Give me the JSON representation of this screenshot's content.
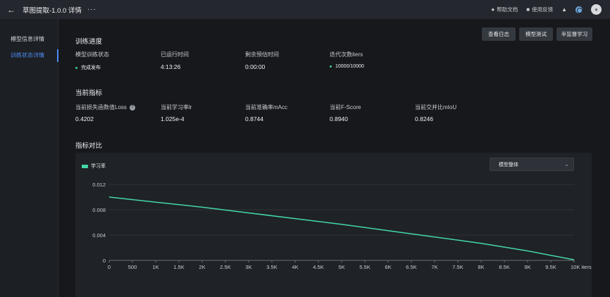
{
  "topbar": {
    "title": "草图提取-1.0.0 详情",
    "more": "···",
    "links": [
      {
        "label": "帮助文档",
        "icon": "lightbulb-icon"
      },
      {
        "label": "使用反馈",
        "icon": "feedback-icon"
      }
    ]
  },
  "sidebar": {
    "items": [
      {
        "label": "模型信息详情"
      },
      {
        "label": "训练状态详情"
      }
    ]
  },
  "actions": {
    "log": "查看日志",
    "test": "模型测试",
    "semi": "半监督学习"
  },
  "progress": {
    "title": "训练进度",
    "status_label": "模型训练状态",
    "status_value": "完成发布",
    "elapsed_label": "已运行时间",
    "elapsed_value": "4:13:26",
    "remaining_label": "剩余预估时间",
    "remaining_value": "0:00:00",
    "iter_label": "迭代次数iters",
    "iter_value": "10000/10000"
  },
  "metrics": {
    "title": "当前指标",
    "loss_label": "当前损失函数值Loss",
    "loss_value": "0.4202",
    "lr_label": "当前学习率lr",
    "lr_value": "1.025e-4",
    "macc_label": "当前准确率mAcc",
    "macc_value": "0.8744",
    "f_label": "当前F-Score",
    "f_value": "0.8940",
    "miou_label": "当前交并比mIoU",
    "miou_value": "0.8246"
  },
  "compare": {
    "title": "指标对比",
    "select_value": "模型整体"
  },
  "chart_data": {
    "type": "line",
    "series": [
      {
        "name": "学习率",
        "color": "#44d7a8",
        "x": [
          0,
          1000,
          2000,
          3000,
          4000,
          5000,
          6000,
          7000,
          8000,
          9000,
          10000
        ],
        "y": [
          0.01,
          0.0092,
          0.0084,
          0.0075,
          0.0066,
          0.0057,
          0.0047,
          0.0037,
          0.0027,
          0.0015,
          0.0001
        ]
      }
    ],
    "x_ticks": [
      "0",
      "500",
      "1K",
      "1.5K",
      "2K",
      "2.5K",
      "3K",
      "3.5K",
      "4K",
      "4.5K",
      "5K",
      "5.5K",
      "6K",
      "6.5K",
      "7K",
      "7.5K",
      "8K",
      "8.5K",
      "9K",
      "9.5K",
      "10K"
    ],
    "x_unit": "iters",
    "y_ticks": [
      "0",
      "0.004",
      "0.008",
      "0.012"
    ],
    "xlim": [
      0,
      10000
    ],
    "ylim": [
      0,
      0.012
    ],
    "grid": true,
    "legend": "top-left"
  }
}
